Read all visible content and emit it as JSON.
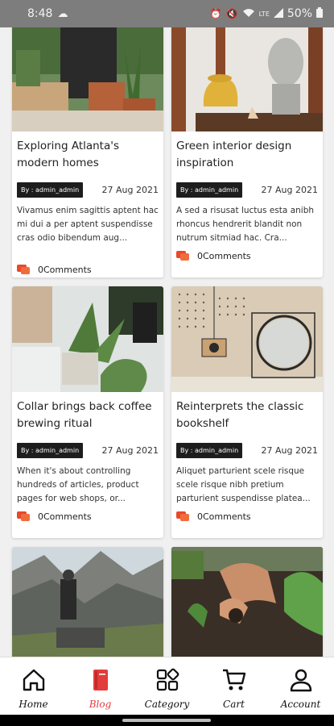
{
  "status_bar": {
    "time": "8:48",
    "battery": "50%",
    "network": "LTE"
  },
  "posts": [
    {
      "title": "Exploring Atlanta's modern homes",
      "author": "By : admin_admin",
      "date": "27 Aug 2021",
      "excerpt": "Vivamus enim sagittis aptent hac mi dui a per aptent suspendisse cras odio bibendum aug...",
      "comments": "0Comments",
      "image": "plants-potting-photo"
    },
    {
      "title": "Green interior design inspiration",
      "author": "By : admin_admin",
      "date": "27 Aug 2021",
      "excerpt": "A sed a risusat luctus esta anibh rhoncus hendrerit blandit non nutrum sitmiad hac. Cra...",
      "comments": "0Comments",
      "image": "vase-sculpture-photo"
    },
    {
      "title": "Collar brings back coffee brewing ritual",
      "author": "By : admin_admin",
      "date": "27 Aug 2021",
      "excerpt": "When it's about controlling hundreds of articles, product pages for web shops, or...",
      "comments": "0Comments",
      "image": "houseplants-photo"
    },
    {
      "title": "Reinterprets the classic bookshelf",
      "author": "By : admin_admin",
      "date": "27 Aug 2021",
      "excerpt": "Aliquet parturient scele risque scele risque nibh pretium parturient suspendisse platea...",
      "comments": "0Comments",
      "image": "pegboard-mirror-photo"
    },
    {
      "image": "mountain-hiker-photo"
    },
    {
      "image": "seedlings-soil-photo"
    }
  ],
  "nav": [
    {
      "label": "Home",
      "icon": "home-icon"
    },
    {
      "label": "Blog",
      "icon": "blog-icon"
    },
    {
      "label": "Category",
      "icon": "category-icon"
    },
    {
      "label": "Cart",
      "icon": "cart-icon"
    },
    {
      "label": "Account",
      "icon": "account-icon"
    }
  ],
  "colors": {
    "accent": "#e23c3c",
    "comment_icon": "#e8492a",
    "author_badge": "#1d1d1d"
  }
}
